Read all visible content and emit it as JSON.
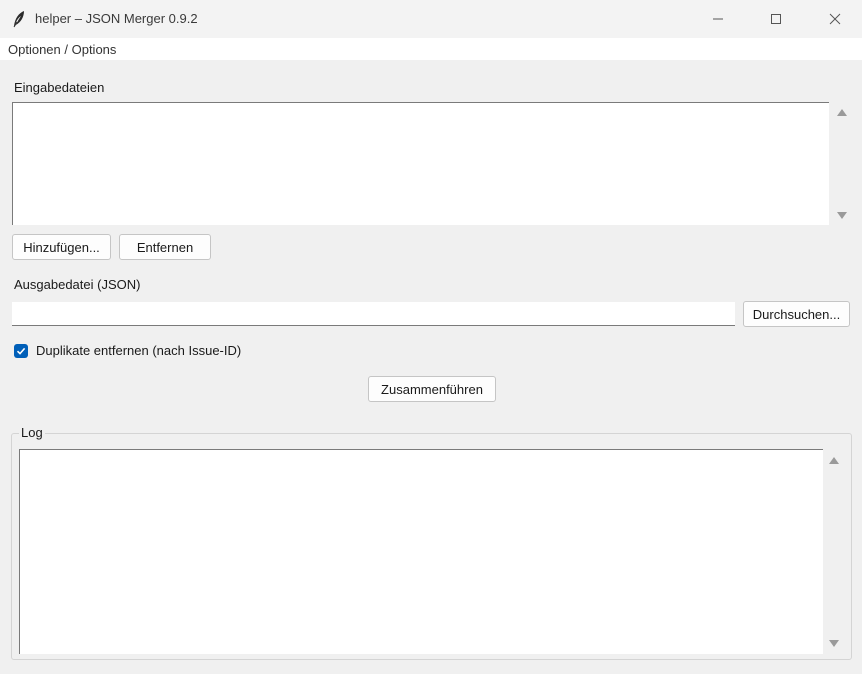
{
  "window": {
    "title": "helper – JSON Merger  0.9.2"
  },
  "menu": {
    "options_label": "Optionen / Options"
  },
  "input_files": {
    "label": "Eingabedateien",
    "add_button": "Hinzufügen...",
    "remove_button": "Entfernen"
  },
  "output": {
    "label": "Ausgabedatei (JSON)",
    "value": "",
    "browse_button": "Durchsuchen..."
  },
  "dedupe": {
    "label": "Duplikate entfernen (nach Issue-ID)",
    "checked": true
  },
  "merge_button": "Zusammenführen",
  "log": {
    "title": "Log"
  },
  "colors": {
    "accent": "#005fb8",
    "background": "#f0f0f0"
  }
}
